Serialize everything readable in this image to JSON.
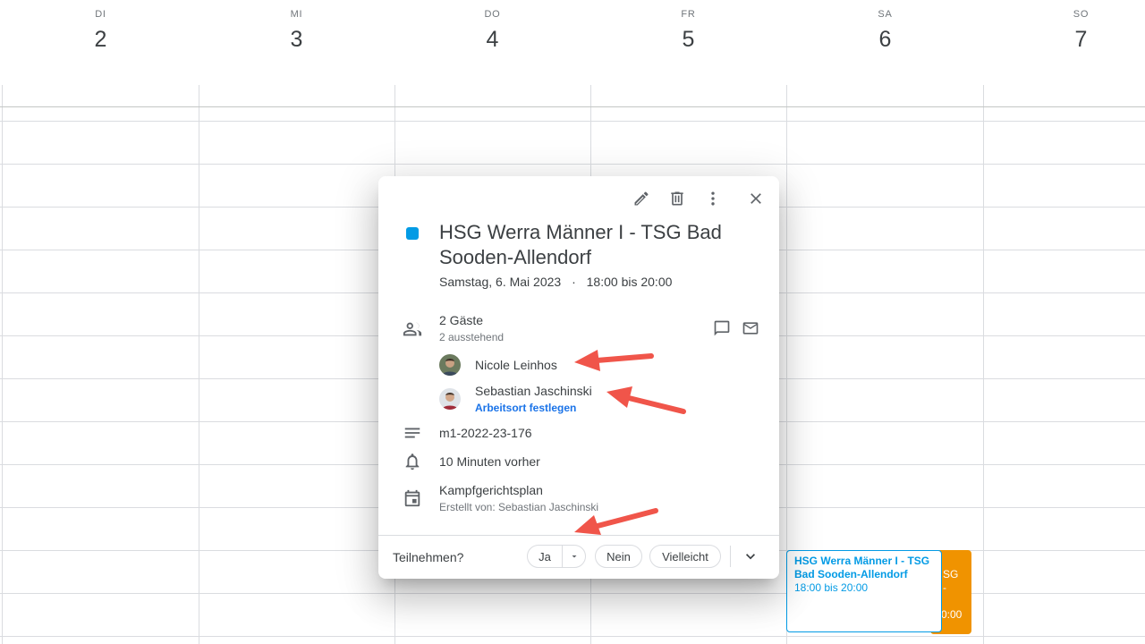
{
  "week": {
    "days": [
      {
        "dow": "DI",
        "num": "2"
      },
      {
        "dow": "MI",
        "num": "3"
      },
      {
        "dow": "DO",
        "num": "4"
      },
      {
        "dow": "FR",
        "num": "5"
      },
      {
        "dow": "SA",
        "num": "6"
      },
      {
        "dow": "SO",
        "num": "7"
      }
    ]
  },
  "events": {
    "main": {
      "title_line1": "HSG Werra Männer I - TSG",
      "title_line2": "Bad Sooden-Allendorf",
      "time": "18:00 bis 20:00"
    },
    "behind": {
      "fragment1": "SG",
      "fragment2": "-",
      "fragment3": "0:00"
    }
  },
  "popup": {
    "title": "HSG Werra Männer I - TSG Bad Sooden-Allendorf",
    "date": "Samstag, 6. Mai 2023",
    "separator": "·",
    "time": "18:00 bis 20:00",
    "guests": {
      "count": "2 Gäste",
      "status": "2 ausstehend",
      "list": [
        {
          "name": "Nicole Leinhos"
        },
        {
          "name": "Sebastian Jaschinski",
          "link": "Arbeitsort festlegen"
        }
      ]
    },
    "description": "m1-2022-23-176",
    "reminder": "10 Minuten vorher",
    "calendar": {
      "name": "Kampfgerichtsplan",
      "creator": "Erstellt von: Sebastian Jaschinski"
    },
    "rsvp": {
      "label": "Teilnehmen?",
      "yes": "Ja",
      "no": "Nein",
      "maybe": "Vielleicht"
    }
  },
  "colors": {
    "event_blue": "#039be5",
    "event_orange": "#f09300",
    "annotation_arrow": "#f0554a"
  }
}
